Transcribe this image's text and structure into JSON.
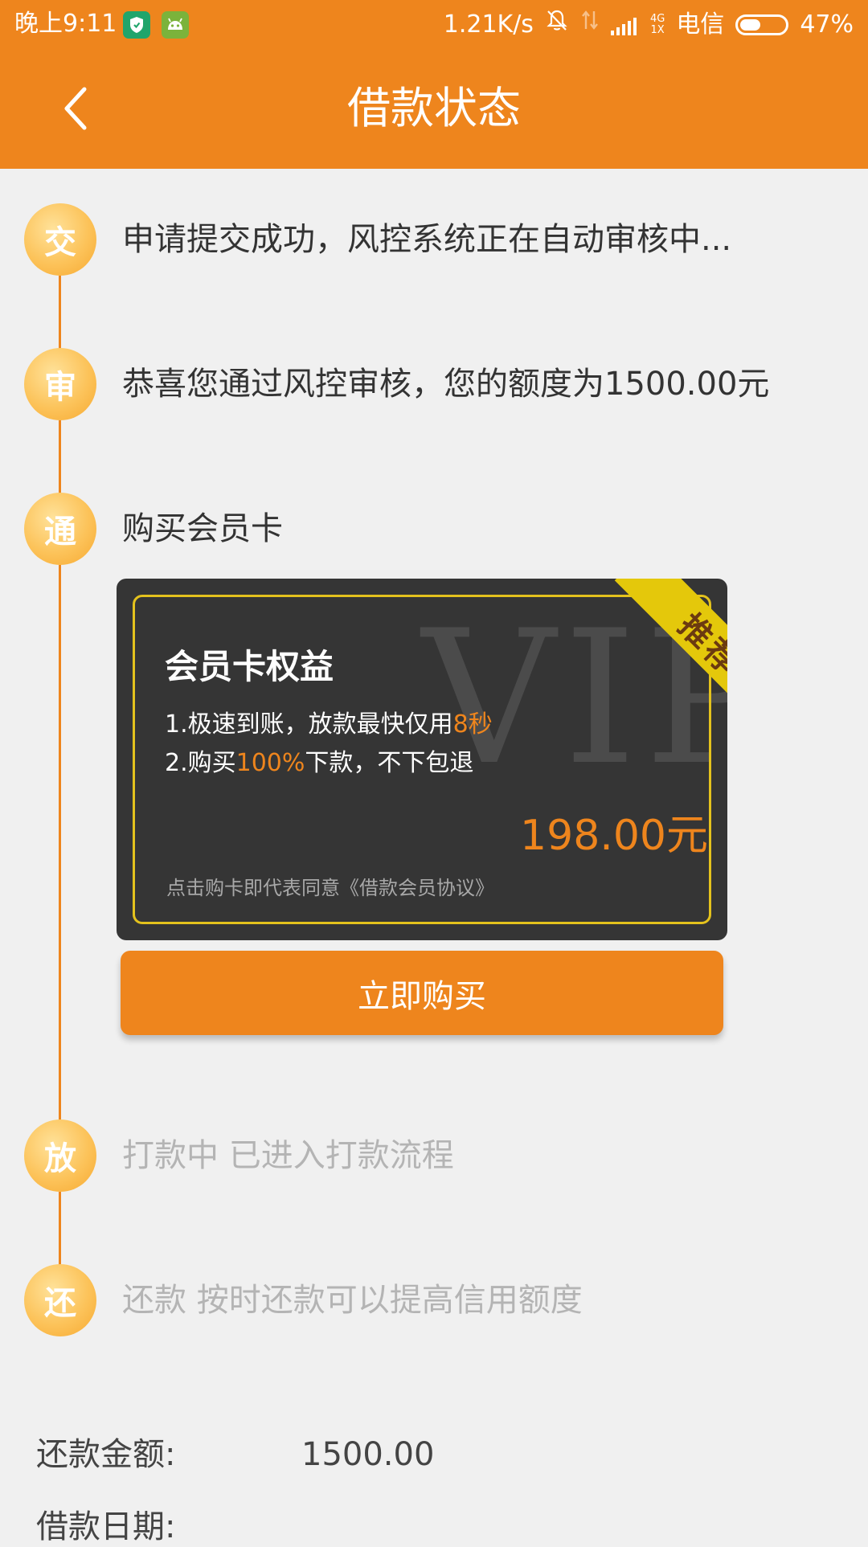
{
  "status_bar": {
    "time": "晚上9:11",
    "net_speed": "1.21K/s",
    "net_type_top": "4G",
    "net_type_bottom": "1X",
    "carrier": "电信",
    "battery": "47%",
    "battery_level": 0.47,
    "icons": [
      "shield-icon",
      "android-icon",
      "mute-bell-icon",
      "data-arrows-icon",
      "signal-icon",
      "battery-icon"
    ]
  },
  "header": {
    "title": "借款状态",
    "back_icon": "chevron-left-icon"
  },
  "steps": [
    {
      "badge": "交",
      "text": "申请提交成功，风控系统正在自动审核中..."
    },
    {
      "badge": "审",
      "text": "恭喜您通过风控审核，您的额度为1500.00元"
    },
    {
      "badge": "通",
      "text": "购买会员卡"
    },
    {
      "badge": "放",
      "text": "打款中 已进入打款流程"
    },
    {
      "badge": "还",
      "text": "还款 按时还款可以提高信用额度"
    }
  ],
  "vip_card": {
    "watermark": "VIP",
    "ribbon": "推荐",
    "title": "会员卡权益",
    "benefit1_prefix": "1.极速到账，放款最快仅用",
    "benefit1_highlight": "8秒",
    "benefit2_prefix": "2.购买",
    "benefit2_highlight": "100%",
    "benefit2_suffix": "下款，不下包退",
    "price": "198.00元",
    "agreement": "点击购卡即代表同意《借款会员协议》"
  },
  "buy_button": {
    "label": "立即购买"
  },
  "details": {
    "repay_amount_label": "还款金额:",
    "repay_amount_value": "1500.00",
    "loan_date_label": "借款日期:"
  },
  "colors": {
    "accent": "#ee851d",
    "ribbon": "#e4c80b",
    "card": "#353535"
  }
}
